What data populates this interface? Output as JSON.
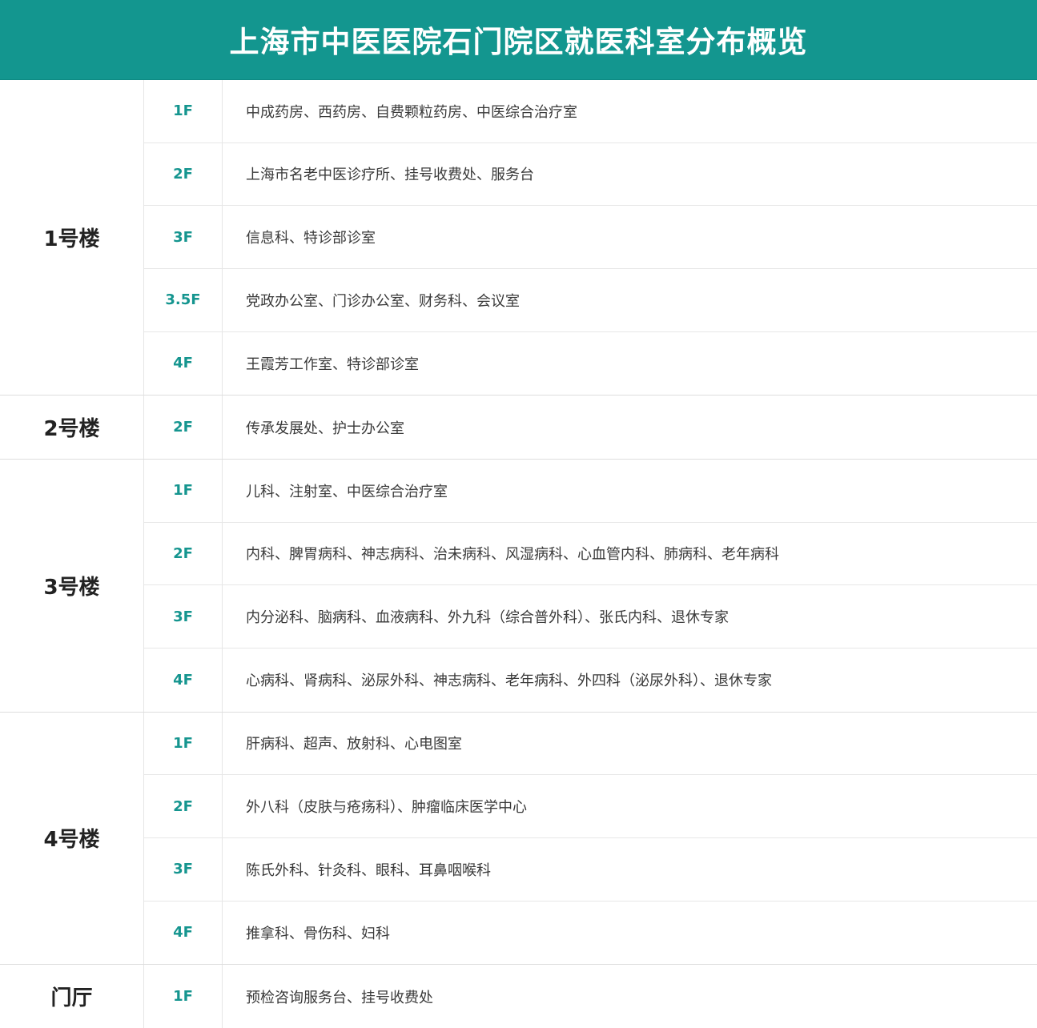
{
  "header": {
    "title": "上海市中医医院石门院区就医科室分布概览"
  },
  "buildings": [
    {
      "name": "1号楼",
      "floors": [
        {
          "floor": "1F",
          "departments": "中成药房、西药房、自费颗粒药房、中医综合治疗室"
        },
        {
          "floor": "2F",
          "departments": "上海市名老中医诊疗所、挂号收费处、服务台"
        },
        {
          "floor": "3F",
          "departments": "信息科、特诊部诊室"
        },
        {
          "floor": "3.5F",
          "departments": "党政办公室、门诊办公室、财务科、会议室"
        },
        {
          "floor": "4F",
          "departments": "王霞芳工作室、特诊部诊室"
        }
      ]
    },
    {
      "name": "2号楼",
      "floors": [
        {
          "floor": "2F",
          "departments": "传承发展处、护士办公室"
        }
      ]
    },
    {
      "name": "3号楼",
      "floors": [
        {
          "floor": "1F",
          "departments": "儿科、注射室、中医综合治疗室"
        },
        {
          "floor": "2F",
          "departments": "内科、脾胃病科、神志病科、治未病科、风湿病科、心血管内科、肺病科、老年病科"
        },
        {
          "floor": "3F",
          "departments": "内分泌科、脑病科、血液病科、外九科（综合普外科）、张氏内科、退休专家"
        },
        {
          "floor": "4F",
          "departments": "心病科、肾病科、泌尿外科、神志病科、老年病科、外四科（泌尿外科）、退休专家"
        }
      ]
    },
    {
      "name": "4号楼",
      "floors": [
        {
          "floor": "1F",
          "departments": "肝病科、超声、放射科、心电图室"
        },
        {
          "floor": "2F",
          "departments": "外八科（皮肤与疮疡科）、肿瘤临床医学中心"
        },
        {
          "floor": "3F",
          "departments": "陈氏外科、针灸科、眼科、耳鼻咽喉科"
        },
        {
          "floor": "4F",
          "departments": "推拿科、骨伤科、妇科"
        }
      ]
    },
    {
      "name": "门厅",
      "floors": [
        {
          "floor": "1F",
          "departments": "预检咨询服务台、挂号收费处"
        }
      ]
    }
  ]
}
